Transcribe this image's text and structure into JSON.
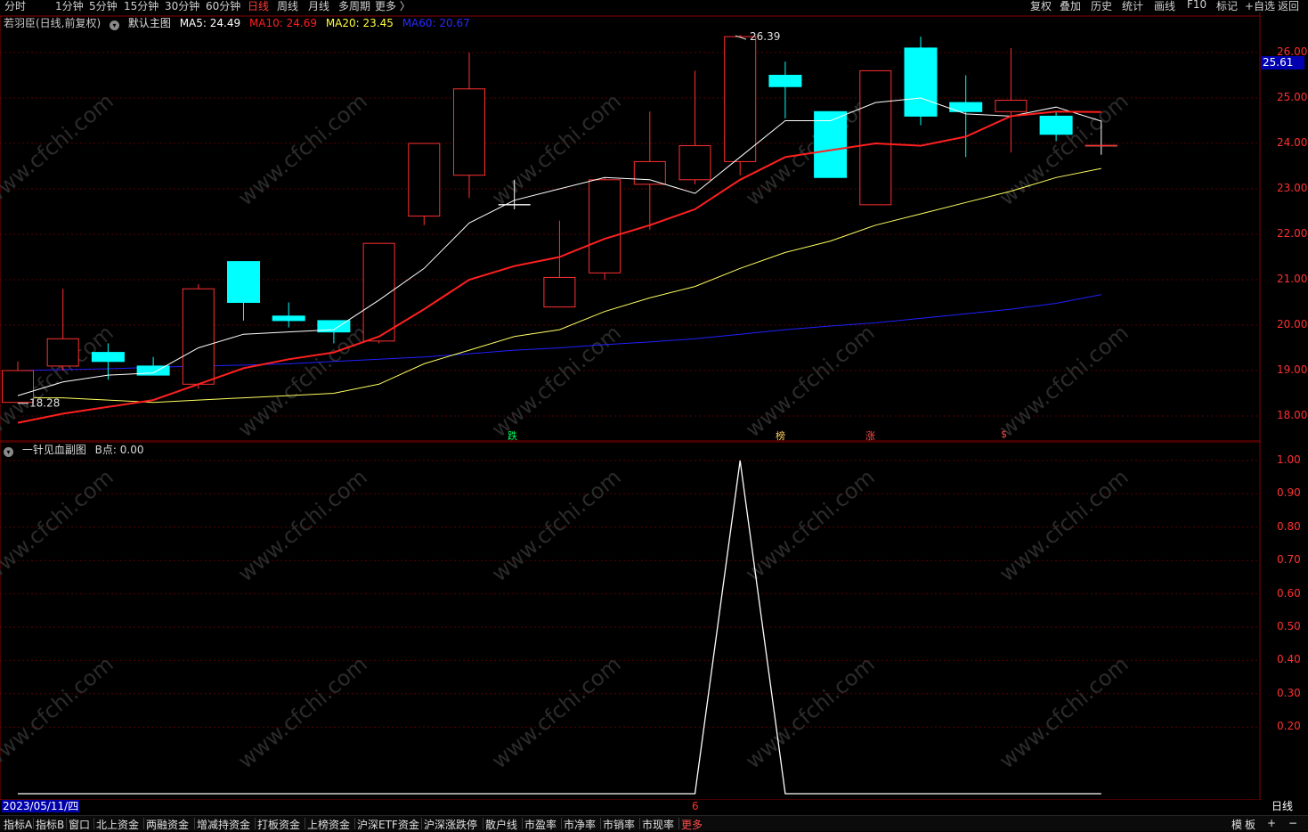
{
  "period_bar": [
    "分时",
    "1分钟",
    "5分钟",
    "15分钟",
    "30分钟",
    "60分钟",
    "日线",
    "周线",
    "月线",
    "多周期",
    "更多 〉"
  ],
  "period_active": "日线",
  "right_tools": [
    "复权",
    "叠加",
    "历史",
    "统计",
    "画线",
    "F10",
    "标记",
    "+自选",
    "返回"
  ],
  "main_legend": {
    "title": "若羽臣(日线,前复权)",
    "template": "默认主图",
    "ma5": "MA5: 24.49",
    "ma10": "MA10: 24.69",
    "ma20": "MA20: 23.45",
    "ma60": "MA60: 20.67"
  },
  "sub_legend": {
    "title": "一针见血副图",
    "value": "B点: 0.00"
  },
  "price_tag": "25.61",
  "price_axis": [
    "26.00",
    "25.00",
    "24.00",
    "23.00",
    "22.00",
    "21.00",
    "20.00",
    "19.00",
    "18.00"
  ],
  "sub_axis": [
    "1.00",
    "0.90",
    "0.80",
    "0.70",
    "0.60",
    "0.50",
    "0.40",
    "0.30",
    "0.20"
  ],
  "annotations": {
    "high": "26.39",
    "low": "18.28"
  },
  "event_flags": [
    {
      "text": "跌",
      "color": "green"
    },
    {
      "text": "榜",
      "color": "gold"
    },
    {
      "text": "涨",
      "color": "red"
    },
    {
      "text": "$",
      "color": "red"
    }
  ],
  "date_label": "2023/05/11/四",
  "x_marker": "6",
  "period_label": "日线",
  "bottom_tabs": [
    "指标A",
    "指标B",
    "窗口",
    "北上资金",
    "两融资金",
    "增减持资金",
    "打板资金",
    "上榜资金",
    "沪深ETF资金",
    "沪深涨跌停",
    "散户线",
    "市盈率",
    "市净率",
    "市销率",
    "市现率",
    "更多"
  ],
  "bottom_right": [
    "模",
    "板",
    "+",
    "−"
  ],
  "watermark": "www.cfchi.com",
  "colors": {
    "up": "#ff3030",
    "down": "#00ffff",
    "ma5": "#ffffff",
    "ma10": "#ff2020",
    "ma20": "#ffff60",
    "ma60": "#2020ff",
    "grid": "#5a0000"
  },
  "chart_data": {
    "type": "candlestick",
    "ylim": [
      17.6,
      26.9
    ],
    "candles": [
      {
        "o": 19.0,
        "h": 19.2,
        "l": 18.28,
        "c": 18.3,
        "dir": "up"
      },
      {
        "o": 19.1,
        "h": 20.8,
        "l": 19.0,
        "c": 19.7,
        "dir": "up"
      },
      {
        "o": 19.4,
        "h": 19.6,
        "l": 18.8,
        "c": 19.2,
        "dir": "down"
      },
      {
        "o": 19.1,
        "h": 19.3,
        "l": 18.9,
        "c": 18.9,
        "dir": "down"
      },
      {
        "o": 18.7,
        "h": 20.9,
        "l": 18.6,
        "c": 20.8,
        "dir": "up"
      },
      {
        "o": 21.4,
        "h": 21.4,
        "l": 20.1,
        "c": 20.5,
        "dir": "down"
      },
      {
        "o": 20.2,
        "h": 20.5,
        "l": 19.95,
        "c": 20.1,
        "dir": "down"
      },
      {
        "o": 20.1,
        "h": 20.1,
        "l": 19.6,
        "c": 19.85,
        "dir": "down"
      },
      {
        "o": 19.65,
        "h": 21.8,
        "l": 19.6,
        "c": 21.8,
        "dir": "up"
      },
      {
        "o": 22.4,
        "h": 22.4,
        "l": 22.2,
        "c": 24.0,
        "dir": "up"
      },
      {
        "o": 23.3,
        "h": 26.0,
        "l": 22.8,
        "c": 25.2,
        "dir": "up"
      },
      {
        "o": 22.65,
        "h": 23.2,
        "l": 22.55,
        "c": 22.65,
        "dir": "flat"
      },
      {
        "o": 20.4,
        "h": 22.3,
        "l": 20.4,
        "c": 21.05,
        "dir": "up"
      },
      {
        "o": 21.15,
        "h": 23.25,
        "l": 21.0,
        "c": 23.2,
        "dir": "up"
      },
      {
        "o": 23.1,
        "h": 24.7,
        "l": 22.1,
        "c": 23.6,
        "dir": "up"
      },
      {
        "o": 23.2,
        "h": 25.6,
        "l": 23.1,
        "c": 23.95,
        "dir": "up"
      },
      {
        "o": 23.6,
        "h": 26.39,
        "l": 23.3,
        "c": 26.35,
        "dir": "up"
      },
      {
        "o": 25.5,
        "h": 25.8,
        "l": 24.55,
        "c": 25.25,
        "dir": "down"
      },
      {
        "o": 24.7,
        "h": 24.7,
        "l": 23.25,
        "c": 23.25,
        "dir": "down"
      },
      {
        "o": 22.65,
        "h": 25.6,
        "l": 22.65,
        "c": 25.6,
        "dir": "up"
      },
      {
        "o": 26.1,
        "h": 26.35,
        "l": 24.4,
        "c": 24.6,
        "dir": "down"
      },
      {
        "o": 24.9,
        "h": 25.5,
        "l": 23.7,
        "c": 24.7,
        "dir": "down"
      },
      {
        "o": 24.7,
        "h": 26.1,
        "l": 23.8,
        "c": 24.95,
        "dir": "up"
      },
      {
        "o": 24.6,
        "h": 24.7,
        "l": 24.05,
        "c": 24.2,
        "dir": "down"
      },
      {
        "o": 23.95,
        "h": 24.5,
        "l": 23.75,
        "c": 23.95,
        "dir": "flat"
      }
    ],
    "ma5": [
      18.45,
      18.75,
      18.9,
      18.95,
      19.5,
      19.8,
      19.85,
      19.9,
      20.55,
      21.25,
      22.25,
      22.75,
      23.0,
      23.25,
      23.2,
      22.9,
      23.7,
      24.5,
      24.5,
      24.9,
      25.0,
      24.65,
      24.6,
      24.8,
      24.49
    ],
    "ma10": [
      17.85,
      18.05,
      18.2,
      18.35,
      18.7,
      19.05,
      19.25,
      19.4,
      19.75,
      20.35,
      21.0,
      21.3,
      21.5,
      21.9,
      22.2,
      22.55,
      23.2,
      23.7,
      23.85,
      24.0,
      23.95,
      24.15,
      24.6,
      24.7,
      24.69
    ],
    "ma20": [
      18.4,
      18.4,
      18.35,
      18.3,
      18.35,
      18.4,
      18.45,
      18.5,
      18.7,
      19.15,
      19.45,
      19.75,
      19.9,
      20.3,
      20.6,
      20.85,
      21.25,
      21.6,
      21.85,
      22.2,
      22.45,
      22.7,
      22.95,
      23.25,
      23.45
    ],
    "ma60": [
      19.0,
      19.02,
      19.04,
      19.07,
      19.1,
      19.12,
      19.15,
      19.2,
      19.25,
      19.3,
      19.37,
      19.45,
      19.5,
      19.57,
      19.63,
      19.7,
      19.8,
      19.9,
      19.98,
      20.05,
      20.15,
      20.25,
      20.35,
      20.48,
      20.67
    ],
    "sub": {
      "ylim": [
        0,
        1.0
      ],
      "values": [
        0,
        0,
        0,
        0,
        0,
        0,
        0,
        0,
        0,
        0,
        0,
        0,
        0,
        0,
        0,
        0,
        1,
        0,
        0,
        0,
        0,
        0,
        0,
        0,
        0
      ]
    }
  }
}
